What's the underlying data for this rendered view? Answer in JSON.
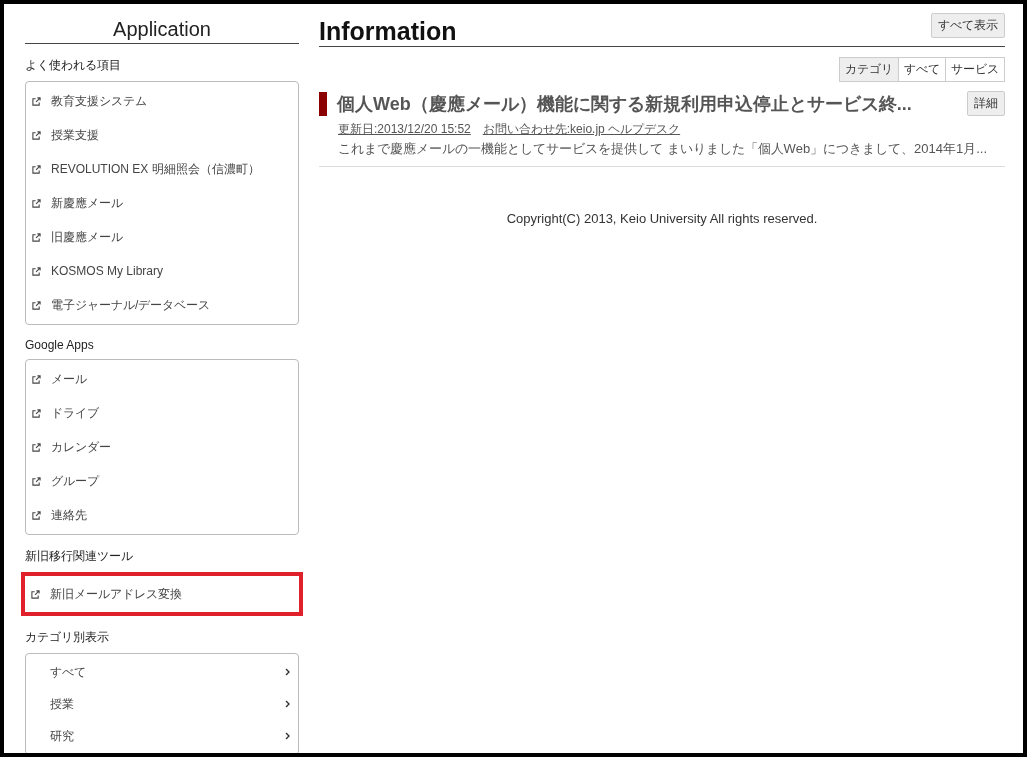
{
  "sidebar": {
    "title": "Application",
    "groups": [
      {
        "heading": "よく使われる項目",
        "kind": "links",
        "highlighted": false,
        "items": [
          "教育支援システム",
          "授業支援",
          "REVOLUTION EX 明細照会（信濃町）",
          "新慶應メール",
          "旧慶應メール",
          "KOSMOS My Library",
          "電子ジャーナル/データベース"
        ]
      },
      {
        "heading": "Google Apps",
        "kind": "links",
        "highlighted": false,
        "items": [
          "メール",
          "ドライブ",
          "カレンダー",
          "グループ",
          "連絡先"
        ]
      },
      {
        "heading": "新旧移行関連ツール",
        "kind": "links",
        "highlighted": true,
        "items": [
          "新旧メールアドレス変換"
        ]
      },
      {
        "heading": "カテゴリ別表示",
        "kind": "categories",
        "highlighted": false,
        "items": [
          "すべて",
          "授業",
          "研究"
        ]
      }
    ]
  },
  "main": {
    "title": "Information",
    "show_all_button": "すべて表示",
    "filters": [
      {
        "label": "カテゴリ",
        "selected": true
      },
      {
        "label": "すべて",
        "selected": false
      },
      {
        "label": "サービス",
        "selected": false
      }
    ],
    "news": [
      {
        "title": "個人Web（慶應メール）機能に関する新規利用申込停止とサービス終...",
        "updated": "更新日:2013/12/20 15:52",
        "contact": "お問い合わせ先:keio.jp ヘルプデスク",
        "summary": "これまで慶應メールの一機能としてサービスを提供して まいりました「個人Web」につきまして、2014年1月...",
        "detail_button": "詳細",
        "color": "#8b0000"
      }
    ],
    "copyright": "Copyright(C) 2013, Keio University All rights reserved."
  }
}
